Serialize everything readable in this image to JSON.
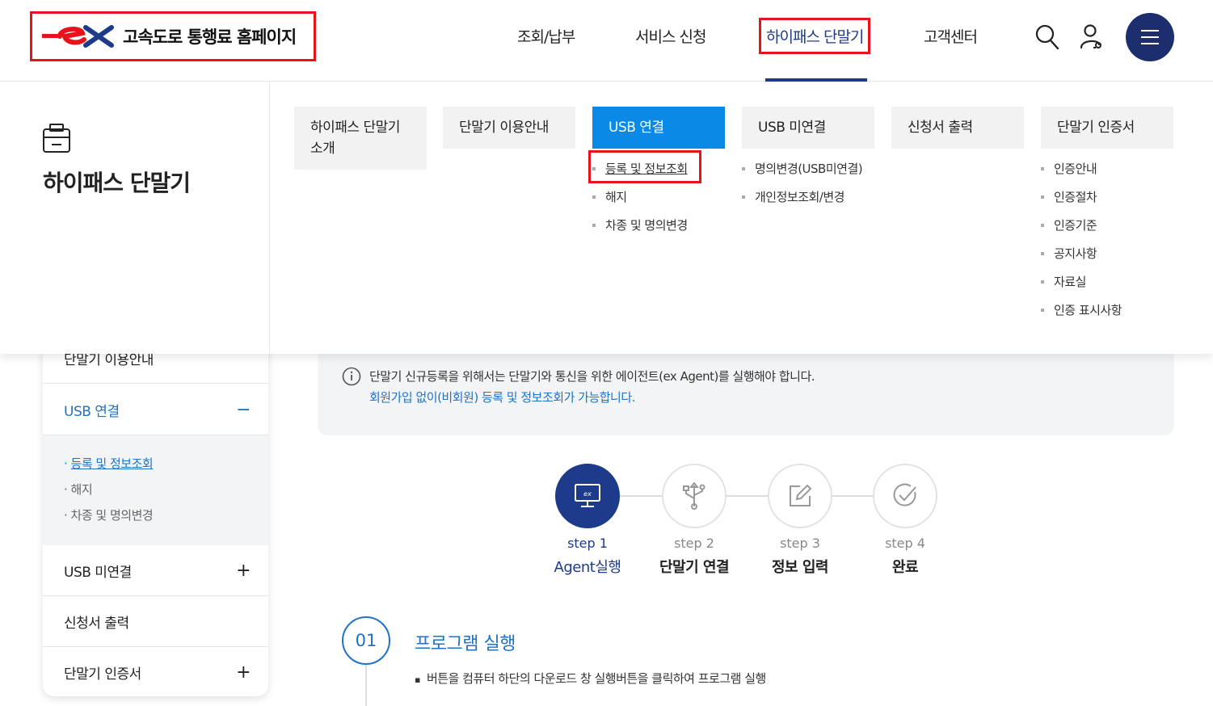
{
  "header": {
    "logo_text": "고속도로 통행료 홈페이지",
    "nav": [
      {
        "label": "조회/납부"
      },
      {
        "label": "서비스 신청"
      },
      {
        "label": "하이패스 단말기"
      },
      {
        "label": "고객센터"
      }
    ],
    "active_nav": "하이패스 단말기",
    "icons": [
      "search-icon",
      "user-icon",
      "menu-icon"
    ]
  },
  "mega_menu": {
    "section_title": "하이패스 단말기",
    "columns": [
      {
        "label": "하이패스 단말기 소개",
        "items": []
      },
      {
        "label": "단말기 이용안내",
        "items": []
      },
      {
        "label": "USB 연결",
        "items": [
          "등록 및 정보조회",
          "해지",
          "차종 및 명의변경"
        ]
      },
      {
        "label": "USB 미연결",
        "items": [
          "명의변경(USB미연결)",
          "개인정보조회/변경"
        ]
      },
      {
        "label": "신청서 출력",
        "items": []
      },
      {
        "label": "단말기 인증서",
        "items": [
          "인증안내",
          "인증절차",
          "인증기준",
          "공지사항",
          "자료실",
          "인증 표시사항"
        ]
      }
    ],
    "active_column": "USB 연결",
    "current_item": "등록 및 정보조회"
  },
  "side_nav": {
    "items": [
      {
        "label": "단말기 이용안내"
      },
      {
        "label": "USB 연결",
        "sign": "−"
      },
      {
        "label": "USB 미연결",
        "sign": "+"
      },
      {
        "label": "신청서 출력"
      },
      {
        "label": "단말기 인증서",
        "sign": "+"
      }
    ],
    "sub_items": [
      "등록 및 정보조회",
      "해지",
      "차종 및 명의변경"
    ]
  },
  "notice": {
    "line1": "단말기 신규등록을 위해서는 단말기와 통신을 위한 에이전트(ex Agent)를 실행해야 합니다.",
    "line2": "회원가입 없이(비회원) 등록 및 정보조회가 가능합니다."
  },
  "steps": [
    {
      "label": "step 1",
      "name": "Agent실행",
      "icon": "monitor-icon"
    },
    {
      "label": "step 2",
      "name": "단말기 연결",
      "icon": "usb-icon"
    },
    {
      "label": "step 3",
      "name": "정보 입력",
      "icon": "edit-icon"
    },
    {
      "label": "step 4",
      "name": "완료",
      "icon": "check-icon"
    }
  ],
  "active_step": 1,
  "section": {
    "number": "01",
    "title": "프로그램 실행",
    "desc": "버튼을 컴퓨터 하단의 다운로드 창 실행버튼을 클릭하여 프로그램 실행"
  },
  "colors": {
    "brand_navy": "#1d3b8a",
    "accent_blue": "#0a8ae6",
    "link_blue": "#1e72c8",
    "highlight_red": "#e8131a"
  }
}
